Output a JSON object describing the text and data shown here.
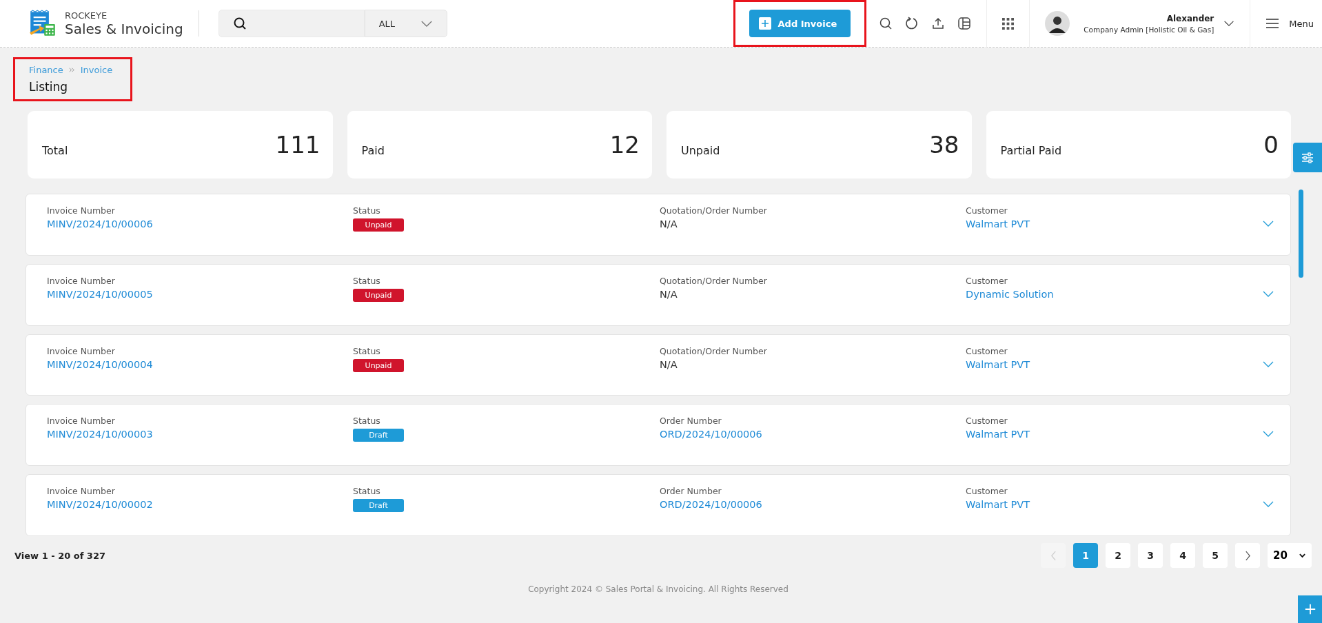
{
  "brand": {
    "company": "ROCKEYE",
    "app": "Sales & Invoicing"
  },
  "search": {
    "scope": "ALL"
  },
  "add_invoice": {
    "label": "Add Invoice",
    "highlighted": true
  },
  "user": {
    "name": "Alexander",
    "role": "Company Admin [Holistic Oil & Gas]"
  },
  "menu_label": "Menu",
  "breadcrumb": {
    "items": [
      "Finance",
      "Invoice"
    ],
    "title": "Listing",
    "highlighted": true
  },
  "stats": [
    {
      "label": "Total",
      "value": "111"
    },
    {
      "label": "Paid",
      "value": "12"
    },
    {
      "label": "Unpaid",
      "value": "38"
    },
    {
      "label": "Partial Paid",
      "value": "0"
    }
  ],
  "invoices": [
    {
      "number_label": "Invoice Number",
      "number": "MINV/2024/10/00006",
      "status_label": "Status",
      "status": "Unpaid",
      "color": "#d0142c",
      "ref_label": "Quotation/Order Number",
      "ref": "N/A",
      "ref_link": false,
      "customer_label": "Customer",
      "customer": "Walmart PVT"
    },
    {
      "number_label": "Invoice Number",
      "number": "MINV/2024/10/00005",
      "status_label": "Status",
      "status": "Unpaid",
      "color": "#d0142c",
      "ref_label": "Quotation/Order Number",
      "ref": "N/A",
      "ref_link": false,
      "customer_label": "Customer",
      "customer": "Dynamic Solution"
    },
    {
      "number_label": "Invoice Number",
      "number": "MINV/2024/10/00004",
      "status_label": "Status",
      "status": "Unpaid",
      "color": "#d0142c",
      "ref_label": "Quotation/Order Number",
      "ref": "N/A",
      "ref_link": false,
      "customer_label": "Customer",
      "customer": "Walmart PVT"
    },
    {
      "number_label": "Invoice Number",
      "number": "MINV/2024/10/00003",
      "status_label": "Status",
      "status": "Draft",
      "color": "#1e9bd7",
      "ref_label": "Order Number",
      "ref": "ORD/2024/10/00006",
      "ref_link": true,
      "customer_label": "Customer",
      "customer": "Walmart PVT"
    },
    {
      "number_label": "Invoice Number",
      "number": "MINV/2024/10/00002",
      "status_label": "Status",
      "status": "Draft",
      "color": "#1e9bd7",
      "ref_label": "Order Number",
      "ref": "ORD/2024/10/00006",
      "ref_link": true,
      "customer_label": "Customer",
      "customer": "Walmart PVT"
    }
  ],
  "view_count": "View 1 - 20 of 327",
  "pages": [
    {
      "label": "1",
      "selected": true
    },
    {
      "label": "2",
      "selected": false
    },
    {
      "label": "3",
      "selected": false
    },
    {
      "label": "4",
      "selected": false
    },
    {
      "label": "5",
      "selected": false
    }
  ],
  "page_size": "20",
  "footer": "Copyright 2024 © Sales Portal & Invoicing. All Rights Reserved"
}
